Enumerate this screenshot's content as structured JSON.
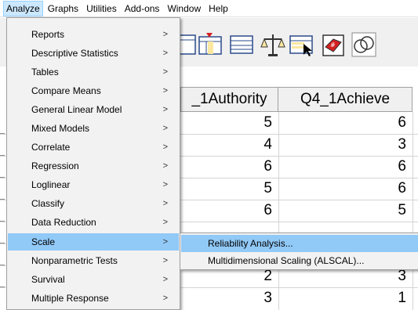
{
  "menubar": {
    "items": [
      {
        "label": "Analyze",
        "active": true
      },
      {
        "label": "Graphs"
      },
      {
        "label": "Utilities"
      },
      {
        "label": "Add-ons"
      },
      {
        "label": "Window"
      },
      {
        "label": "Help"
      }
    ]
  },
  "toolbar": {
    "icons": [
      "go-to-case-icon",
      "go-to-variable-icon",
      "variables-icon",
      "split-file-icon",
      "select-cases-icon",
      "value-labels-icon",
      "use-sets-icon"
    ]
  },
  "grid": {
    "columns": [
      "_1Authority",
      "Q4_1Achieve"
    ],
    "rows": [
      [
        "5",
        "6"
      ],
      [
        "4",
        "3"
      ],
      [
        "6",
        "6"
      ],
      [
        "5",
        "6"
      ],
      [
        "6",
        "5"
      ],
      [
        "",
        ""
      ],
      [
        "",
        ""
      ],
      [
        "2",
        "3"
      ],
      [
        "3",
        "1"
      ]
    ]
  },
  "analyze_menu": {
    "items": [
      {
        "label": "Reports",
        "submenu": true
      },
      {
        "label": "Descriptive Statistics",
        "submenu": true
      },
      {
        "label": "Tables",
        "submenu": true
      },
      {
        "label": "Compare Means",
        "submenu": true
      },
      {
        "label": "General Linear Model",
        "submenu": true
      },
      {
        "label": "Mixed Models",
        "submenu": true
      },
      {
        "label": "Correlate",
        "submenu": true
      },
      {
        "label": "Regression",
        "submenu": true
      },
      {
        "label": "Loglinear",
        "submenu": true
      },
      {
        "label": "Classify",
        "submenu": true
      },
      {
        "label": "Data Reduction",
        "submenu": true
      },
      {
        "label": "Scale",
        "submenu": true,
        "highlighted": true
      },
      {
        "label": "Nonparametric Tests",
        "submenu": true
      },
      {
        "label": "Survival",
        "submenu": true
      },
      {
        "label": "Multiple Response",
        "submenu": true
      }
    ],
    "arrow_glyph": ">"
  },
  "scale_submenu": {
    "items": [
      {
        "label": "Reliability Analysis...",
        "highlighted": true
      },
      {
        "label": "Multidimensional Scaling (ALSCAL)..."
      }
    ]
  },
  "colors": {
    "highlight": "#91c9f7",
    "menubar_active": "#cce8ff",
    "menu_bg": "#f2f2f2",
    "toolbar_bg": "#f0f0f0"
  }
}
